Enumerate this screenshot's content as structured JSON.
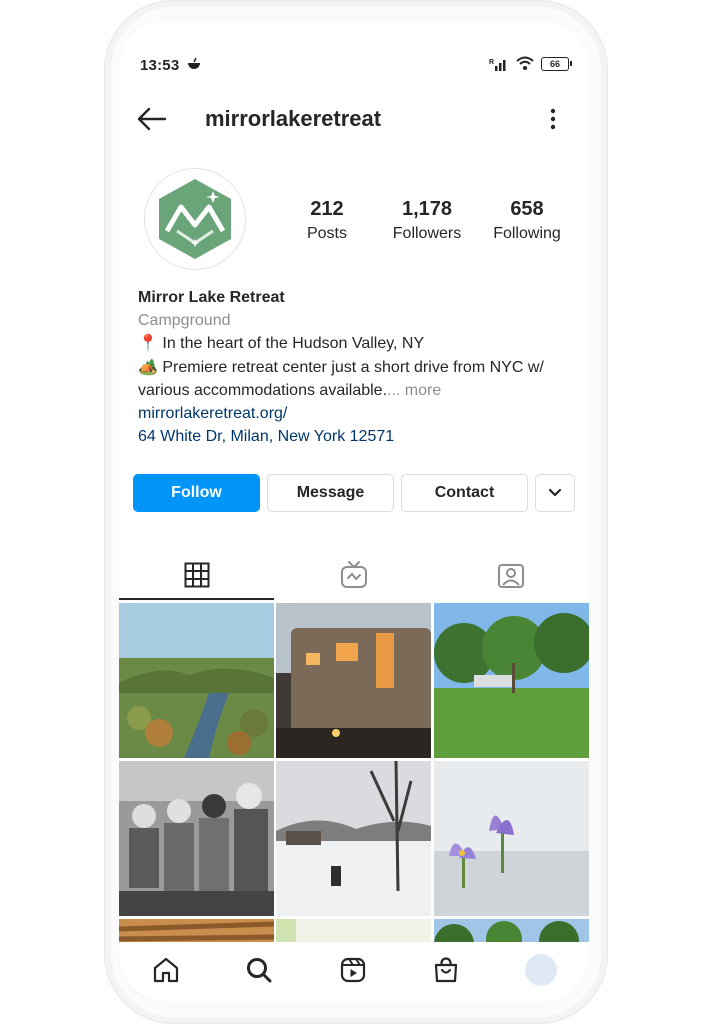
{
  "status_bar": {
    "time": "13:53",
    "battery": "66"
  },
  "header": {
    "username": "mirrorlakeretreat"
  },
  "stats": [
    {
      "value": "212",
      "label": "Posts"
    },
    {
      "value": "1,178",
      "label": "Followers"
    },
    {
      "value": "658",
      "label": "Following"
    }
  ],
  "bio": {
    "name": "Mirror Lake Retreat",
    "category": "Campground",
    "line1_emoji": "📍",
    "line1": "In the heart of the Hudson Valley, NY",
    "line2_emoji": "🏕️",
    "line2": "Premiere retreat center just a short drive from NYC w/ various accommodations available.",
    "more": "... more",
    "website": "mirrorlakeretreat.org/",
    "address": "64 White Dr, Milan, New York 12571"
  },
  "buttons": {
    "follow": "Follow",
    "message": "Message",
    "contact": "Contact"
  },
  "colors": {
    "accent": "#0095f6",
    "link": "#00376b",
    "muted": "#8e8e8e",
    "logo_green": "#6aa57a"
  },
  "tabs": [
    "grid-icon",
    "igtv-icon",
    "tagged-icon"
  ],
  "bottom_nav": [
    "home-icon",
    "search-icon",
    "reels-icon",
    "shop-icon",
    "profile-avatar"
  ]
}
